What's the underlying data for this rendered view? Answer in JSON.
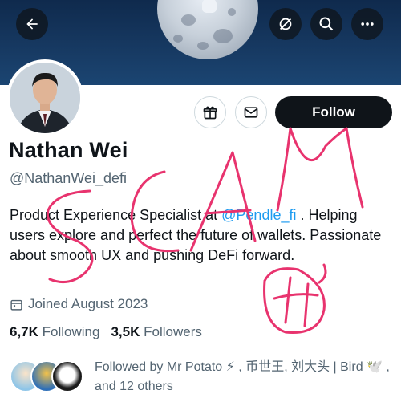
{
  "profile": {
    "name": "Nathan Wei",
    "handle": "@NathanWei_defi",
    "bio_before": "Product Experience Specialist at ",
    "bio_mention": "@Pendle_fi",
    "bio_after": " . Helping users explore and perfect the future of wallets. Passionate about smooth UX and pushing DeFi forward.",
    "joined": "Joined August 2023"
  },
  "actions": {
    "follow_label": "Follow"
  },
  "stats": {
    "following_count": "6,7K",
    "following_label": "Following",
    "followers_count": "3,5K",
    "followers_label": "Followers"
  },
  "followed_by": {
    "text_lead": "Followed by Mr Potato ⚡ , 币世王, 刘大头 | Bird 🕊️ , and 12 others"
  },
  "icons": [
    "back-arrow-icon",
    "hide-icon",
    "search-icon",
    "more-icon",
    "gift-icon",
    "mail-icon",
    "calendar-icon"
  ],
  "overlay": {
    "text": "SCAM",
    "color": "#e8336e"
  },
  "colors": {
    "accent": "#1d9bf0",
    "follow_bg": "#0f1419",
    "muted": "#536471"
  }
}
